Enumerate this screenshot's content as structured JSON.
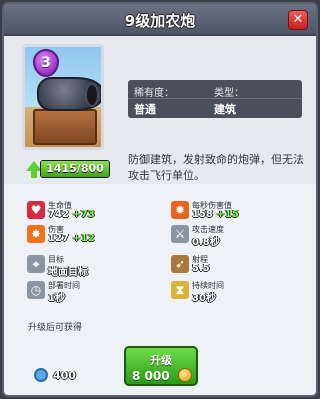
{
  "header": {
    "title": "9级加农炮",
    "close_label": "✕"
  },
  "card": {
    "elixir_cost": "3",
    "progress_text": "1415/800",
    "progress_fraction": 1.0
  },
  "info": {
    "rarity_label": "稀有度：",
    "rarity_value": "普通",
    "type_label": "类型：",
    "type_value": "建筑"
  },
  "description": "防御建筑，发射致命的炮弹，但无法攻击飞行单位。",
  "stats": [
    {
      "label": "生命值",
      "value": "742",
      "bonus": "+73",
      "icon": "heart-icon",
      "style": "green"
    },
    {
      "label": "每秒伤害值",
      "value": "158",
      "bonus": "+15",
      "icon": "dps-icon",
      "style": "green"
    },
    {
      "label": "伤害",
      "value": "127",
      "bonus": "+12",
      "icon": "damage-icon",
      "style": "green"
    },
    {
      "label": "攻击速度",
      "value": "0.8秒",
      "bonus": "",
      "icon": "sword-icon",
      "style": "gray"
    },
    {
      "label": "目标",
      "value": "地面目标",
      "bonus": "",
      "icon": "target-icon",
      "style": "gray"
    },
    {
      "label": "射程",
      "value": "5.5",
      "bonus": "",
      "icon": "bow-icon",
      "style": "gray"
    },
    {
      "label": "部署时间",
      "value": "1秒",
      "bonus": "",
      "icon": "clock-icon",
      "style": "gray"
    },
    {
      "label": "持续时间",
      "value": "30秒",
      "bonus": "",
      "icon": "hourglass-icon",
      "style": "gray"
    }
  ],
  "footer": {
    "exp_label": "升级后可获得",
    "exp_value": "400"
  },
  "upgrade": {
    "label": "升级",
    "cost": "8 000"
  },
  "colors": {
    "accent_green": "#3ea31b",
    "header": "#5a6172",
    "close_red": "#d32a2a"
  }
}
